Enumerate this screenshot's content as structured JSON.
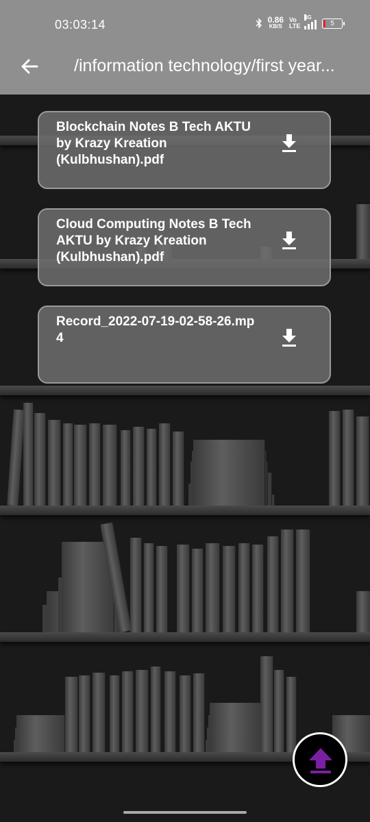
{
  "status": {
    "time": "03:03:14",
    "net_speed": "0.86",
    "net_unit": "KB/S",
    "volte": "Vo LTE",
    "network_type": "4G",
    "battery": "5"
  },
  "appbar": {
    "path": "/information technology/first year..."
  },
  "files": [
    {
      "name": "Blockchain Notes B Tech AKTU by Krazy Kreation (Kulbhushan).pdf"
    },
    {
      "name": "Cloud Computing Notes B Tech AKTU by Krazy Kreation (Kulbhushan).pdf"
    },
    {
      "name": "Record_2022-07-19-02-58-26.mp4"
    }
  ],
  "icons": {
    "back": "arrow-left-icon",
    "download": "download-icon",
    "upload": "upload-icon",
    "bluetooth": "bluetooth-icon",
    "signal": "signal-icon",
    "battery": "battery-icon"
  },
  "colors": {
    "appbar": "#8f8f8f",
    "fab_icon": "#7b1fa2",
    "card_bg": "#6e6e6e"
  }
}
